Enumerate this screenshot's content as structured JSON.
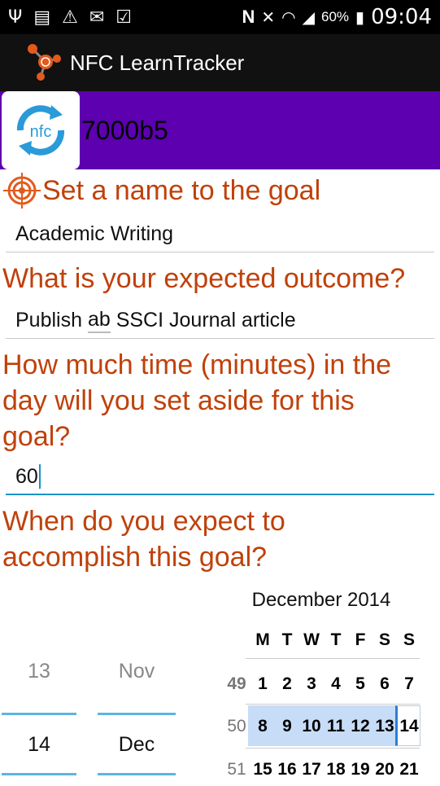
{
  "status": {
    "battery": "60%",
    "clock": "09:04"
  },
  "app": {
    "title": "NFC LearnTracker"
  },
  "banner": {
    "tag_id": "7000b5",
    "logo_text": "nfc"
  },
  "form": {
    "name_label": "Set a name to the goal",
    "name_value": "Academic Writing",
    "outcome_label": "What is your expected outcome?",
    "outcome_value_a": "Publish ",
    "outcome_value_b": "ab",
    "outcome_value_c": " SSCI Journal article",
    "time_label_1": "How much time (minutes) in the",
    "time_label_2": "day will you set aside for this",
    "time_label_3": "goal?",
    "time_value": "60",
    "date_label_1": "When do you expect to",
    "date_label_2": "accomplish this goal?"
  },
  "picker": {
    "day_prev": "13",
    "day_current": "14",
    "month_prev": "Nov",
    "month_current": "Dec"
  },
  "calendar": {
    "title": "December 2014",
    "weekdays": [
      "M",
      "T",
      "W",
      "T",
      "F",
      "S",
      "S"
    ],
    "weeks": [
      {
        "num": "49",
        "days": [
          "1",
          "2",
          "3",
          "4",
          "5",
          "6",
          "7"
        ]
      },
      {
        "num": "50",
        "days": [
          "8",
          "9",
          "10",
          "11",
          "12",
          "13",
          "14"
        ]
      },
      {
        "num": "51",
        "days": [
          "15",
          "16",
          "17",
          "18",
          "19",
          "20",
          "21"
        ]
      }
    ]
  },
  "colors": {
    "accent": "#c0410a",
    "banner": "#5c00b0",
    "focus": "#1a93c8"
  }
}
